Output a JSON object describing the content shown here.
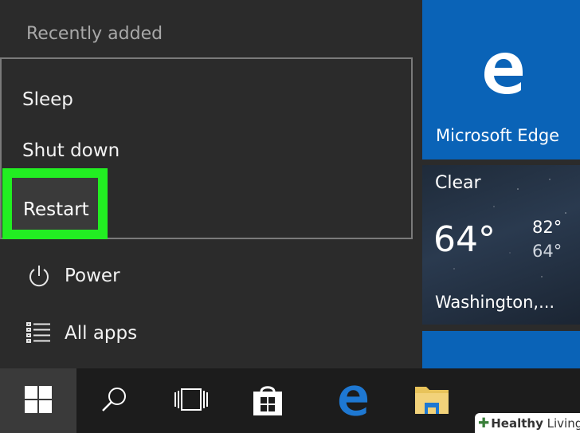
{
  "start_menu": {
    "recently_added_label": "Recently added",
    "power_menu": {
      "items": [
        {
          "label": "Sleep"
        },
        {
          "label": "Shut down"
        },
        {
          "label": "Restart",
          "highlighted": true
        }
      ],
      "highlight_color": "#22ee22"
    },
    "power_label": "Power",
    "all_apps_label": "All apps"
  },
  "tiles": {
    "edge": {
      "label": "Microsoft Edge",
      "color": "#0a63b7"
    },
    "weather": {
      "condition": "Clear",
      "temperature": "64°",
      "high": "82°",
      "low": "64°",
      "city": "Washington,..."
    }
  },
  "taskbar": {
    "icons": [
      "windows-start-icon",
      "search-icon",
      "task-view-icon",
      "store-icon",
      "edge-icon",
      "file-explorer-icon"
    ]
  },
  "watermark": {
    "brand_bold": "Healthy",
    "brand_rest": " Living"
  }
}
